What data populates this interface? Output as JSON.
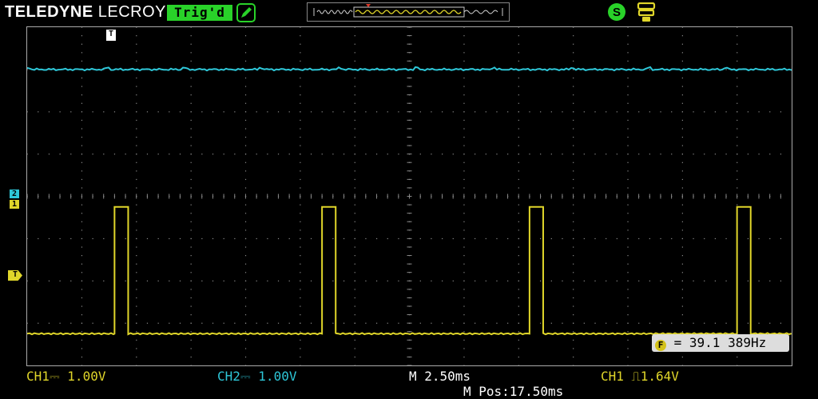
{
  "header": {
    "brand_bold": "TELEDYNE",
    "brand_light": "LECROY",
    "trigger_status": "Trig'd"
  },
  "icons": {
    "pencil": "pencil-icon",
    "s_status": "s-circle-icon",
    "usb": "usb-storage-icon"
  },
  "markers": {
    "trigger_top": "T",
    "ch2_level": "2",
    "ch1_level": "1",
    "trigger_level": "T"
  },
  "colors": {
    "ch1": "#e0d62a",
    "ch2": "#2ec7d8",
    "trig_badge": "#29d229",
    "grid": "#8a8a8a"
  },
  "measurement": {
    "freq_label": "= 39.1 389Hz"
  },
  "status_bar": {
    "ch1": "CH1⎓ 1.00V",
    "ch2": "CH2⎓ 1.00V",
    "timebase": "M 2.50ms",
    "trigger": "CH1 ⎍1.64V",
    "mpos": "M Pos:17.50ms"
  },
  "chart_data": {
    "type": "line",
    "x_divisions": 14,
    "y_divisions": 8,
    "series": [
      {
        "name": "CH2",
        "level_div": 3.0
      },
      {
        "name": "CH1",
        "low_div": -3.25,
        "high_div": -0.25,
        "pulse_start_div": [
          1.6,
          5.4,
          9.2,
          13.0
        ],
        "pulse_width_div": 0.25
      }
    ]
  }
}
